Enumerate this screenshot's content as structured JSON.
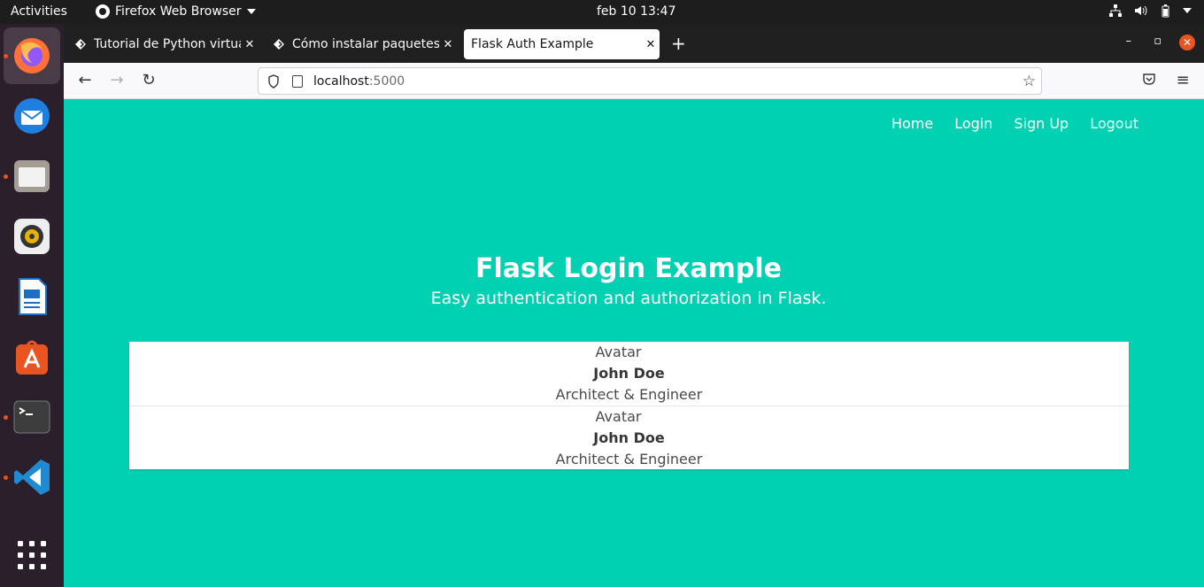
{
  "system": {
    "activities": "Activities",
    "app_name": "Firefox Web Browser",
    "clock": "feb 10  13:47"
  },
  "tabs": [
    {
      "title": "Tutorial de Python virtualenv",
      "active": false
    },
    {
      "title": "Cómo instalar paquetes P",
      "active": false
    },
    {
      "title": "Flask Auth Example",
      "active": true
    }
  ],
  "toolbar": {
    "url_host": "localhost",
    "url_port": ":5000"
  },
  "page": {
    "nav": [
      "Home",
      "Login",
      "Sign Up",
      "Logout"
    ],
    "hero_title": "Flask Login Example",
    "hero_subtitle": "Easy authentication and authorization in Flask.",
    "entries": [
      {
        "avatar": "Avatar",
        "name": "John Doe",
        "role": "Architect & Engineer"
      },
      {
        "avatar": "Avatar",
        "name": "John Doe",
        "role": "Architect & Engineer"
      }
    ]
  },
  "colors": {
    "page_bg": "#00d1b2",
    "accent": "#e95420"
  }
}
